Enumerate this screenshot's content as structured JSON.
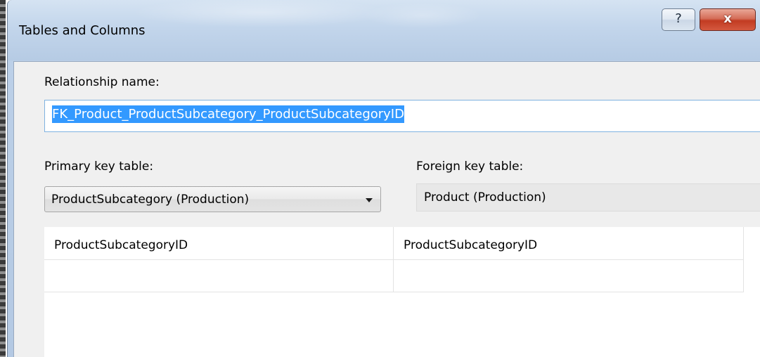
{
  "dialog": {
    "title": "Tables and Columns",
    "help_label": "?",
    "close_label": "x"
  },
  "relationship": {
    "label": "Relationship name:",
    "value": "FK_Product_ProductSubcategory_ProductSubcategoryID"
  },
  "primary_key": {
    "label": "Primary key table:",
    "selected": "ProductSubcategory (Production)"
  },
  "foreign_key": {
    "label": "Foreign key table:",
    "value": "Product (Production)"
  },
  "columns": {
    "rows": [
      [
        "ProductSubcategoryID",
        "ProductSubcategoryID"
      ],
      [
        "",
        ""
      ]
    ]
  },
  "colors": {
    "selection": "#3399ff",
    "close_button": "#c23b22",
    "window_frame": "#bcd0e8"
  }
}
